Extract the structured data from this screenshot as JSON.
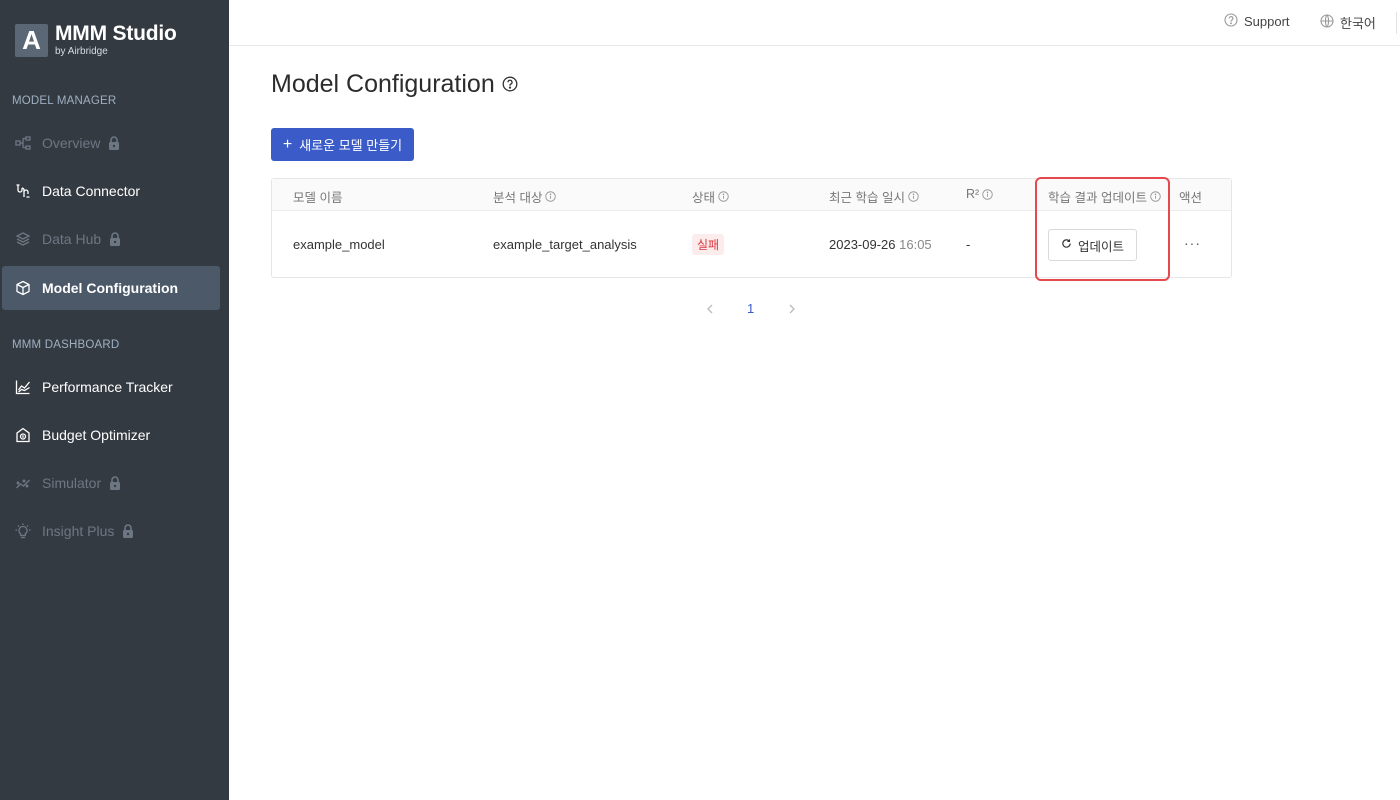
{
  "brand": {
    "mark": "A",
    "title": "MMM Studio",
    "subtitle": "by Airbridge"
  },
  "sidebar": {
    "section_model_manager": "MODEL MANAGER",
    "section_dashboard": "MMM DASHBOARD",
    "items": [
      {
        "label": "Overview",
        "locked": true,
        "icon": "flow-icon"
      },
      {
        "label": "Data Connector",
        "locked": false,
        "icon": "connector-icon"
      },
      {
        "label": "Data Hub",
        "locked": true,
        "icon": "layers-icon"
      },
      {
        "label": "Model Configuration",
        "locked": false,
        "active": true,
        "icon": "cube-icon"
      },
      {
        "label": "Performance Tracker",
        "locked": false,
        "icon": "line-chart-icon"
      },
      {
        "label": "Budget Optimizer",
        "locked": false,
        "icon": "budget-icon"
      },
      {
        "label": "Simulator",
        "locked": true,
        "icon": "scatter-icon"
      },
      {
        "label": "Insight Plus",
        "locked": true,
        "icon": "bulb-icon"
      }
    ]
  },
  "topbar": {
    "support": "Support",
    "language": "한국어"
  },
  "page": {
    "title": "Model Configuration",
    "create_button": "새로운 모델 만들기"
  },
  "table": {
    "headers": {
      "model_name": "모델 이름",
      "target": "분석 대상",
      "status": "상태",
      "last_trained": "최근 학습 일시",
      "r2": "R²",
      "update_results": "학습 결과 업데이트",
      "actions": "액션"
    },
    "rows": [
      {
        "model_name": "example_model",
        "target": "example_target_analysis",
        "status": "실패",
        "date": "2023-09-26",
        "time": "16:05",
        "r2": "-",
        "update_button": "업데이트",
        "actions": "···"
      }
    ]
  },
  "pagination": {
    "current": "1"
  },
  "colors": {
    "sidebar_bg": "#343a42",
    "active_bg": "#4c5968",
    "primary": "#3b5cc8",
    "error": "#d9363e",
    "highlight": "#e5484d"
  }
}
